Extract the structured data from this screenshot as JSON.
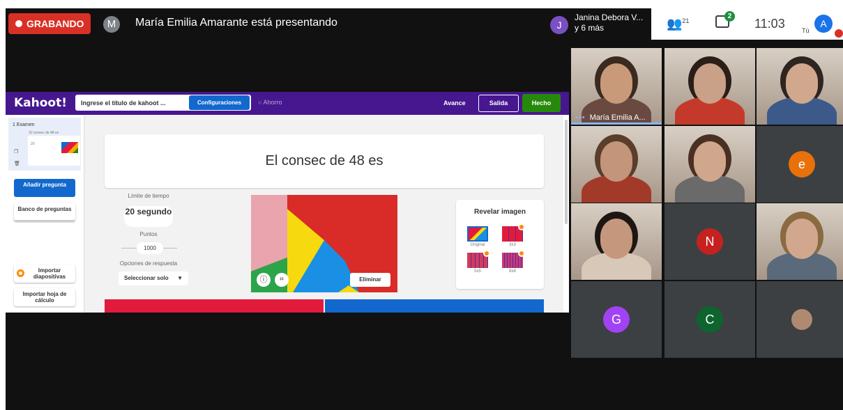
{
  "meet": {
    "recording_label": "GRABANDO",
    "presenter_initial": "M",
    "presenter_text": "María Emilia Amarante está presentando",
    "others_initial": "J",
    "others_name": "Janina Debora V...",
    "others_more": "y 6 más",
    "people_count": "21",
    "chat_badge": "2",
    "time": "11:03",
    "self_label": "Tú",
    "self_initial": "A"
  },
  "kahoot": {
    "logo": "Kahoot!",
    "title_placeholder": "Ingrese el título de kahoot ...",
    "settings_button": "Configuraciones",
    "save_status": "Ahorro",
    "preview_label": "Avance",
    "exit_button": "Salida",
    "done_button": "Hecho",
    "sidebar": {
      "question_number": "1  Examen",
      "question_mini": "El consec de 48 es",
      "thumb_time": "20",
      "add_question": "Añadir pregunta",
      "question_bank": "Banco de preguntas",
      "import_slides": "Importar diapositivas",
      "import_sheet": "Importar hoja de cálculo"
    },
    "question_title": "El consec de 48 es",
    "time_limit_label": "Límite de tiempo",
    "time_limit_value": "20 segundo",
    "points_label": "Puntos",
    "points_value": "1000",
    "answer_options_label": "Opciones de respuesta",
    "answer_options_value": "Seleccionar solo",
    "remove_image": "Eliminar",
    "reveal": {
      "title": "Revelar imagen",
      "options": [
        "Original",
        "3x3",
        "5x5",
        "8x8"
      ]
    }
  },
  "participants": {
    "pinned_name": "María Emilia A...",
    "tiles": [
      "",
      "",
      "",
      "",
      "",
      "e",
      "",
      "N",
      "",
      "G",
      "C",
      ""
    ],
    "avatar_colors": {
      "e": "#e8710a",
      "N": "#c5221f",
      "G": "#a142f4",
      "C": "#0d652d"
    }
  }
}
